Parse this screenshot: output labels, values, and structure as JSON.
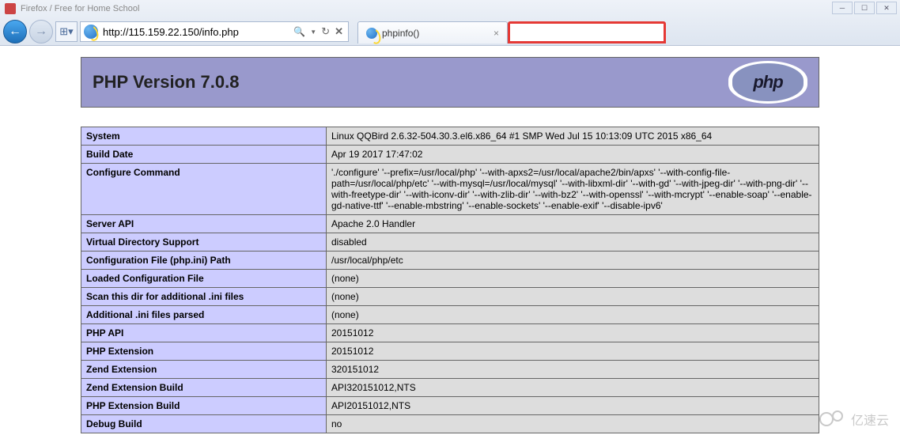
{
  "window": {
    "title_hint": "Firefox / Free for Home School"
  },
  "browser": {
    "url": "http://115.159.22.150/info.php",
    "search_symbol": "🔍",
    "refresh_symbol": "↻",
    "stop_symbol": "✕",
    "compat_symbol": "⊞▾",
    "back_symbol": "←",
    "forward_symbol": "→",
    "tabs": [
      {
        "title": "phpinfo()",
        "close": "×"
      }
    ]
  },
  "phpinfo": {
    "header_title": "PHP Version 7.0.8",
    "logo_text": "php",
    "rows": [
      {
        "k": "System",
        "v": "Linux QQBird 2.6.32-504.30.3.el6.x86_64 #1 SMP Wed Jul 15 10:13:09 UTC 2015 x86_64"
      },
      {
        "k": "Build Date",
        "v": "Apr 19 2017 17:47:02"
      },
      {
        "k": "Configure Command",
        "v": "'./configure' '--prefix=/usr/local/php' '--with-apxs2=/usr/local/apache2/bin/apxs' '--with-config-file-path=/usr/local/php/etc' '--with-mysql=/usr/local/mysql' '--with-libxml-dir' '--with-gd' '--with-jpeg-dir' '--with-png-dir' '--with-freetype-dir' '--with-iconv-dir' '--with-zlib-dir' '--with-bz2' '--with-openssl' '--with-mcrypt' '--enable-soap' '--enable-gd-native-ttf' '--enable-mbstring' '--enable-sockets' '--enable-exif' '--disable-ipv6'"
      },
      {
        "k": "Server API",
        "v": "Apache 2.0 Handler"
      },
      {
        "k": "Virtual Directory Support",
        "v": "disabled"
      },
      {
        "k": "Configuration File (php.ini) Path",
        "v": "/usr/local/php/etc"
      },
      {
        "k": "Loaded Configuration File",
        "v": "(none)"
      },
      {
        "k": "Scan this dir for additional .ini files",
        "v": "(none)"
      },
      {
        "k": "Additional .ini files parsed",
        "v": "(none)"
      },
      {
        "k": "PHP API",
        "v": "20151012"
      },
      {
        "k": "PHP Extension",
        "v": "20151012"
      },
      {
        "k": "Zend Extension",
        "v": "320151012"
      },
      {
        "k": "Zend Extension Build",
        "v": "API320151012,NTS"
      },
      {
        "k": "PHP Extension Build",
        "v": "API20151012,NTS"
      },
      {
        "k": "Debug Build",
        "v": "no"
      }
    ]
  },
  "watermark": {
    "text": "亿速云"
  }
}
